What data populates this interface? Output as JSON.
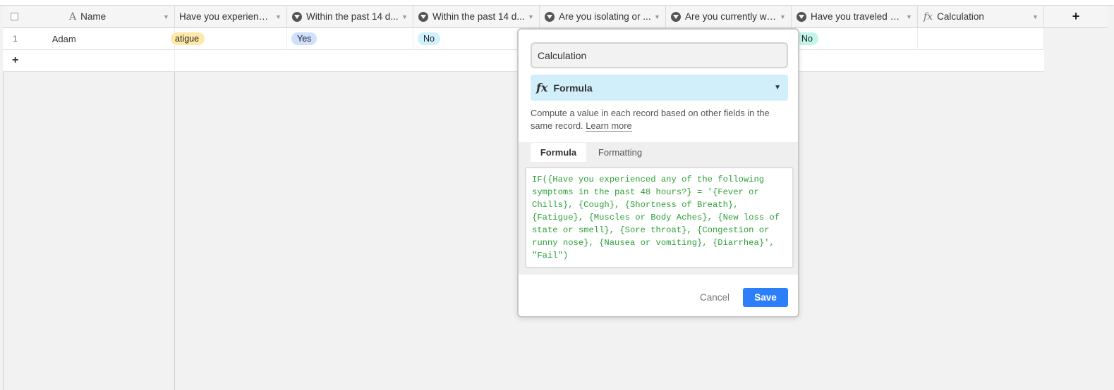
{
  "header": {
    "name_label": "Name",
    "columns": [
      {
        "label": "Have you experience...",
        "icon": "dropdown-circle-icon"
      },
      {
        "label": "Within the past 14 d...",
        "icon": "dropdown-circle-icon"
      },
      {
        "label": "Within the past 14 d...",
        "icon": "dropdown-circle-icon"
      },
      {
        "label": "Are you isolating or ...",
        "icon": "dropdown-circle-icon"
      },
      {
        "label": "Are you currently wai...",
        "icon": "dropdown-circle-icon"
      },
      {
        "label": "Have you traveled ov...",
        "icon": "dropdown-circle-icon"
      },
      {
        "label": "Calculation",
        "icon": "formula-icon"
      }
    ],
    "add_field": "+"
  },
  "rows": [
    {
      "number": "1",
      "name": "Adam",
      "symptom": "atigue",
      "within1": "Yes",
      "within2": "No",
      "traveled": "No"
    }
  ],
  "add_row": "+",
  "dialog": {
    "name_value": "Calculation",
    "type_label": "Formula",
    "description": "Compute a value in each record based on other fields in the same record. ",
    "learn_more": "Learn more",
    "tabs": [
      "Formula",
      "Formatting"
    ],
    "formula": "IF({Have you experienced any of the following symptoms in the past 48 hours?} = '{Fever or Chills}, {Cough}, {Shortness of Breath}, {Fatigue}, {Muscles or Body Aches}, {New loss of state or smell}, {Sore throat}, {Congestion or runny nose}, {Nausea or vomiting}, {Diarrhea}', \"Fail\")",
    "cancel": "Cancel",
    "save": "Save"
  },
  "colors": {
    "pill_yellow": "#ffe9a8",
    "pill_blue": "#cfe0fc",
    "pill_lightblue": "#d0f0fd",
    "pill_green": "#c2f5e9",
    "save_blue": "#2d7ff9",
    "formula_green": "#2e9f3a"
  }
}
